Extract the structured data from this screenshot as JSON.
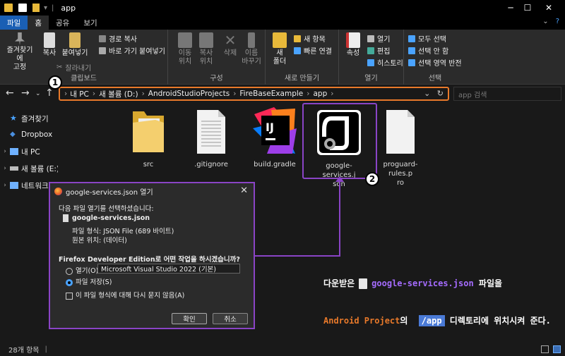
{
  "window": {
    "title": "app",
    "minimize": "─",
    "maximize": "☐",
    "close": "✕"
  },
  "ribbon_tabs": [
    "파일",
    "홈",
    "공유",
    "보기"
  ],
  "ribbon": {
    "clipboard": {
      "label": "클립보드",
      "pin": "즐겨찾기에\n고정",
      "copy": "복사",
      "paste": "붙여넣기",
      "copy_path": "경로 복사",
      "paste_shortcut": "바로 가기 붙여넣기",
      "cut": "잘라내기"
    },
    "organize": {
      "label": "구성",
      "move_to": "이동\n위치",
      "copy_to": "복사\n위치",
      "delete": "삭제",
      "rename": "이름\n바꾸기"
    },
    "new": {
      "label": "새로 만들기",
      "new_folder": "새\n폴더",
      "new_item": "새 항목",
      "easy_access": "빠른 연결"
    },
    "open": {
      "label": "열기",
      "properties": "속성",
      "open": "열기",
      "edit": "편집",
      "history": "히스토리"
    },
    "select": {
      "label": "선택",
      "select_all": "모두 선택",
      "select_none": "선택 안 함",
      "invert": "선택 영역 반전"
    }
  },
  "address": {
    "crumbs": [
      "내 PC",
      "새 볼륨 (D:)",
      "AndroidStudioProjects",
      "FireBaseExample",
      "app"
    ],
    "search_placeholder": "app 검색"
  },
  "sidebar": [
    {
      "label": "즐겨찾기",
      "icon": "star-icon",
      "color": "#4aa3ff"
    },
    {
      "label": "Dropbox",
      "icon": "dropbox-icon",
      "color": "#4a8fe0"
    },
    {
      "label": "내 PC",
      "icon": "pc-icon",
      "color": "#6fb1ff"
    },
    {
      "label": "새 볼륨 (E:)",
      "icon": "drive-icon",
      "color": "#bbbbbb"
    },
    {
      "label": "네트워크",
      "icon": "network-icon",
      "color": "#6fb1ff"
    }
  ],
  "files": [
    {
      "name": "src",
      "type": "folder"
    },
    {
      "name": ".gitignore",
      "type": "text"
    },
    {
      "name": "build.gradle",
      "type": "intellij"
    },
    {
      "name": "google-services.json",
      "type": "json",
      "label_lines": [
        "google-services.j",
        "son"
      ]
    },
    {
      "name": "proguard-rules.pro",
      "type": "blank",
      "label_lines": [
        "proguard-rules.p",
        "ro"
      ]
    }
  ],
  "badges": {
    "one": "1",
    "two": "2"
  },
  "dialog": {
    "title": "google-services.json 열기",
    "prompt": "다음 파일 열기를 선택하셨습니다:",
    "filename": "google-services.json",
    "file_type": "파일 형식: JSON File (689 바이트)",
    "source": "원본 위치: (데이터)",
    "question": "Firefox Developer Edition로 어떤 작업을 하시겠습니까?",
    "open_with": "열기(O):",
    "open_with_app": "Microsoft Visual Studio 2022 (기본)",
    "save_file": "파일 저장(S)",
    "do_not_ask": "이 파일 형식에 대해 다시 묻지 않음(A)",
    "ok": "확인",
    "cancel": "취소"
  },
  "annotation": {
    "line1_pre": "다운받은",
    "line1_file": "google-services.json",
    "line1_post": "파일을",
    "line2_project": "Android Project",
    "line2_of": "의",
    "line2_folder": "/app",
    "line2_post": "디렉토리에 위치시켜 준다."
  },
  "status": {
    "count": "28개 항목"
  },
  "colors": {
    "address_highlight": "#e8792a",
    "purple_highlight": "#8a44c6",
    "file_tab": "#1a5fb4"
  }
}
